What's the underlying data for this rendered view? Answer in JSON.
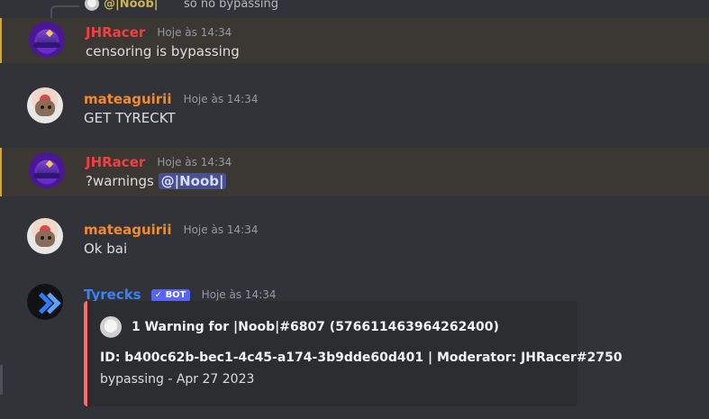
{
  "reply_preview": {
    "mention": "@|Noob|",
    "text": "so no bypassing"
  },
  "messages": [
    {
      "author": "JHRacer",
      "time": "Hoje às 14:34",
      "content": "censoring is bypassing"
    },
    {
      "author": "mateaguirii",
      "time": "Hoje às 14:34",
      "content": "GET TYRECKT"
    },
    {
      "author": "JHRacer",
      "time": "Hoje às 14:34",
      "content_prefix": "?warnings",
      "mention": "@|Noob|"
    },
    {
      "author": "mateaguirii",
      "time": "Hoje às 14:34",
      "content": "Ok bai"
    },
    {
      "author": "Tyrecks",
      "badge": "✓ BOT",
      "time": "Hoje às 14:34",
      "embed": {
        "title": "1 Warning for |Noob|#6807 (576611463964262400)",
        "line1": "ID: b400c62b-bec1-4c45-a174-3b9dde60d401 | Moderator: JHRacer#2750",
        "line2": "bypassing - Apr 27 2023"
      }
    }
  ]
}
